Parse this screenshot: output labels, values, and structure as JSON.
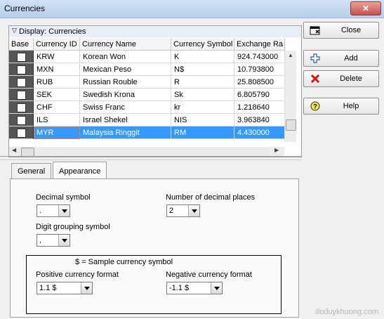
{
  "window": {
    "title": "Currencies",
    "close_glyph": "✕"
  },
  "grid": {
    "display_label": "Display: Currencies",
    "columns": [
      "Base",
      "Currency ID",
      "Currency Name",
      "Currency Symbol",
      "Exchange Ra"
    ],
    "rows": [
      {
        "id": "KRW",
        "name": "Korean Won",
        "symbol": "K",
        "rate": "924.743000",
        "selected": false
      },
      {
        "id": "MXN",
        "name": "Mexican Peso",
        "symbol": "N$",
        "rate": "10.793800",
        "selected": false
      },
      {
        "id": "RUB",
        "name": "Russian Rouble",
        "symbol": "R",
        "rate": "25.808500",
        "selected": false
      },
      {
        "id": "SEK",
        "name": "Swedish Krona",
        "symbol": "Sk",
        "rate": "6.805790",
        "selected": false
      },
      {
        "id": "CHF",
        "name": "Swiss Franc",
        "symbol": "kr",
        "rate": "1.218640",
        "selected": false
      },
      {
        "id": "ILS",
        "name": "Israel Shekel",
        "symbol": "NIS",
        "rate": "3.963840",
        "selected": false
      },
      {
        "id": "MYR",
        "name": "Malaysia Ringgit",
        "symbol": "RM",
        "rate": "4.430000",
        "selected": true
      }
    ]
  },
  "buttons": {
    "close": {
      "label": "Close",
      "icon": "close-window-icon"
    },
    "add": {
      "label": "Add",
      "icon": "plus-icon"
    },
    "delete": {
      "label": "Delete",
      "icon": "red-x-icon"
    },
    "help": {
      "label": "Help",
      "icon": "question-icon"
    }
  },
  "tabs": [
    {
      "label": "General",
      "active": false
    },
    {
      "label": "Appearance",
      "active": true
    }
  ],
  "appearance": {
    "decimal_symbol_label": "Decimal symbol",
    "decimal_symbol_value": ".",
    "decimal_places_label": "Number of decimal places",
    "decimal_places_value": "2",
    "digit_grouping_label": "Digit grouping symbol",
    "digit_grouping_value": ",",
    "sample_label": "$ = Sample currency symbol",
    "positive_label": "Positive currency format",
    "positive_value": "1.1 $",
    "negative_label": "Negative currency format",
    "negative_value": "-1.1 $"
  },
  "watermark": "doduykhuong.com",
  "colors": {
    "selection": "#3399ff",
    "focus": "#e08030"
  }
}
